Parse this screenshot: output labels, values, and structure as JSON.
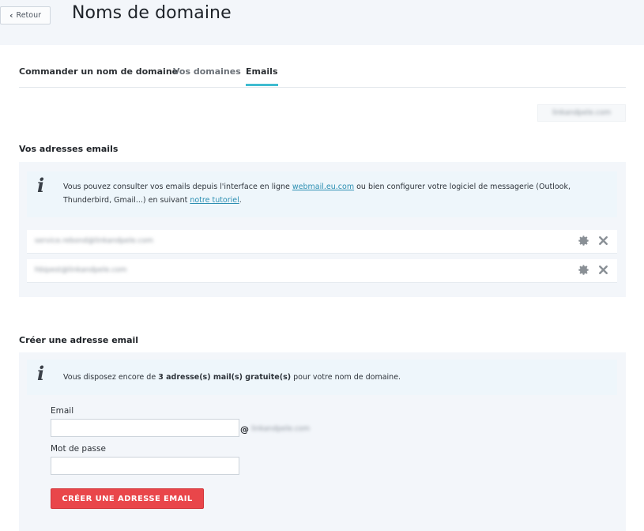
{
  "header": {
    "back_label": "Retour",
    "title": "Noms de domaine"
  },
  "tabs": [
    {
      "label": "Commander un nom de domaine",
      "active": false
    },
    {
      "label": "Vos domaines",
      "active": false
    },
    {
      "label": "Emails",
      "active": true
    }
  ],
  "domain_selector": {
    "value": "linkandpele.com",
    "blurred": true
  },
  "emails_section": {
    "title": "Vos adresses emails",
    "info": {
      "text_before": "Vous pouvez consulter vos emails depuis l'interface en ligne ",
      "webmail_link": "webmail.eu.com",
      "text_middle": " ou bien configurer votre logiciel de messagerie (Outlook, Thunderbird, Gmail...) en suivant ",
      "tutorial_link": "notre tutoriel",
      "text_after": "."
    },
    "addresses": [
      {
        "address": "service.rebond@linkandpele.com",
        "blurred": true
      },
      {
        "address": "hbipest@linkandpele.com",
        "blurred": true
      }
    ],
    "icons": {
      "settings": "gear-icon",
      "delete": "close-icon"
    }
  },
  "create_section": {
    "title": "Créer une adresse email",
    "info": {
      "text_before": "Vous disposez encore de ",
      "highlight": "3 adresse(s) mail(s) gratuite(s)",
      "text_after": " pour votre nom de domaine."
    },
    "email_label": "Email",
    "email_value": "",
    "at_sign": "@",
    "domain_suffix": "linkandpele.com",
    "password_label": "Mot de passe",
    "password_value": "",
    "submit_label": "CRÉER UNE ADRESSE EMAIL"
  },
  "colors": {
    "accent_tab": "#3fbcd0",
    "button": "#e9464a",
    "link": "#2c8fb2",
    "panel_bg": "#f3f6fa"
  }
}
